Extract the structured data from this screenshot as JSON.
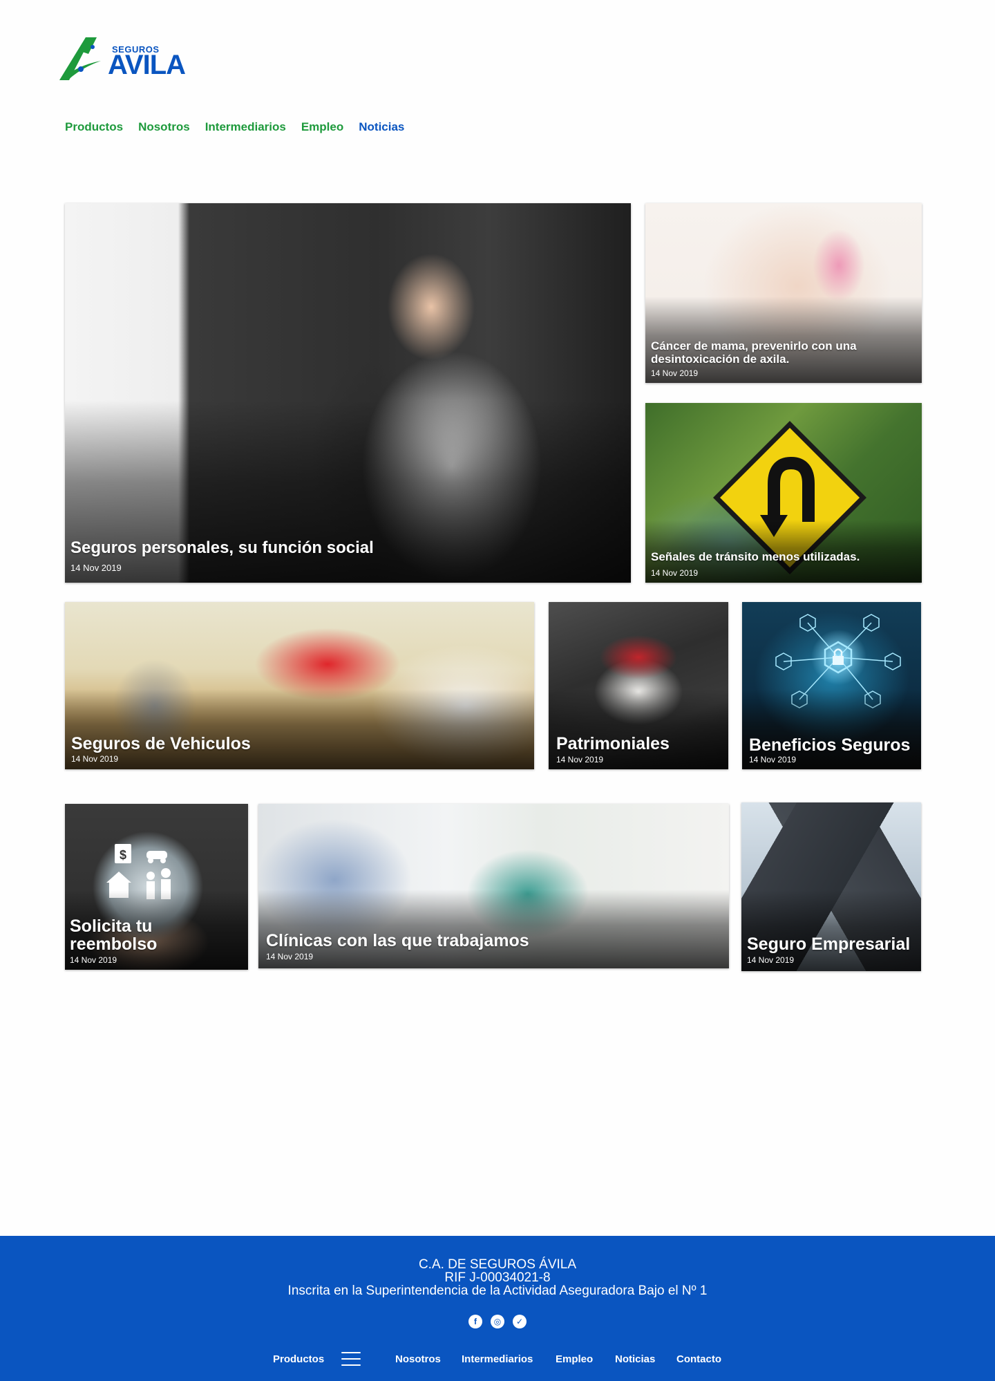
{
  "brand": {
    "small": "SEGUROS",
    "large": "AVILA",
    "green": "#1e9a3c",
    "blue": "#0a55c0"
  },
  "nav": {
    "items": [
      "Productos",
      "Nosotros",
      "Intermediarios",
      "Empleo",
      "Noticias"
    ],
    "active": "Noticias"
  },
  "articles": [
    {
      "title": "Seguros personales, su función social",
      "date": "14 Nov 2019"
    },
    {
      "title": "Cáncer de mama, prevenirlo con una desintoxicación de axila.",
      "date": "14 Nov 2019"
    },
    {
      "title": "Señales de tránsito menos utilizadas.",
      "date": "14 Nov 2019"
    },
    {
      "title": "Seguros de Vehiculos",
      "date": "14 Nov 2019"
    },
    {
      "title": "Patrimoniales",
      "date": "14 Nov 2019"
    },
    {
      "title": "Beneficios Seguros",
      "date": "14 Nov 2019"
    },
    {
      "title": "Solicita tu reembolso",
      "date": "14 Nov 2019"
    },
    {
      "title": "Clínicas con las que trabajamos",
      "date": "14 Nov 2019"
    },
    {
      "title": "Seguro Empresarial",
      "date": "14 Nov 2019"
    }
  ],
  "footer": {
    "company": "C.A. DE SEGUROS ÁVILA",
    "rif": "RIF J-00034021-8",
    "registry": "Inscrita en la Superintendencia de la Actividad Aseguradora Bajo el Nº 1",
    "social": [
      "facebook-icon",
      "instagram-icon",
      "twitter-icon"
    ],
    "nav": [
      "Productos",
      "Nosotros",
      "Intermediarios",
      "Empleo",
      "Noticias",
      "Contacto"
    ],
    "background": "#0a55c0"
  }
}
